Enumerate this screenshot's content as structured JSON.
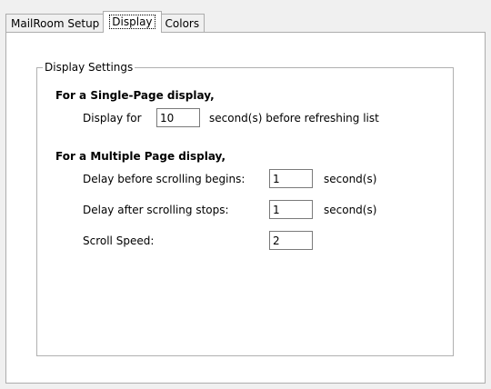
{
  "tabs": [
    {
      "label": "MailRoom Setup"
    },
    {
      "label": "Display"
    },
    {
      "label": "Colors"
    }
  ],
  "active_tab": "Display",
  "group": {
    "title": "Display Settings",
    "single_page": {
      "heading": "For a Single-Page display,",
      "display_for_label": "Display for",
      "display_for_value": "10",
      "display_for_suffix": "second(s) before refreshing list"
    },
    "multi_page": {
      "heading": "For a Multiple Page display,",
      "delay_before_label": "Delay before scrolling begins:",
      "delay_before_value": "1",
      "delay_before_unit": "second(s)",
      "delay_after_label": "Delay after scrolling stops:",
      "delay_after_value": "1",
      "delay_after_unit": "second(s)",
      "scroll_speed_label": "Scroll Speed:",
      "scroll_speed_value": "2"
    }
  }
}
